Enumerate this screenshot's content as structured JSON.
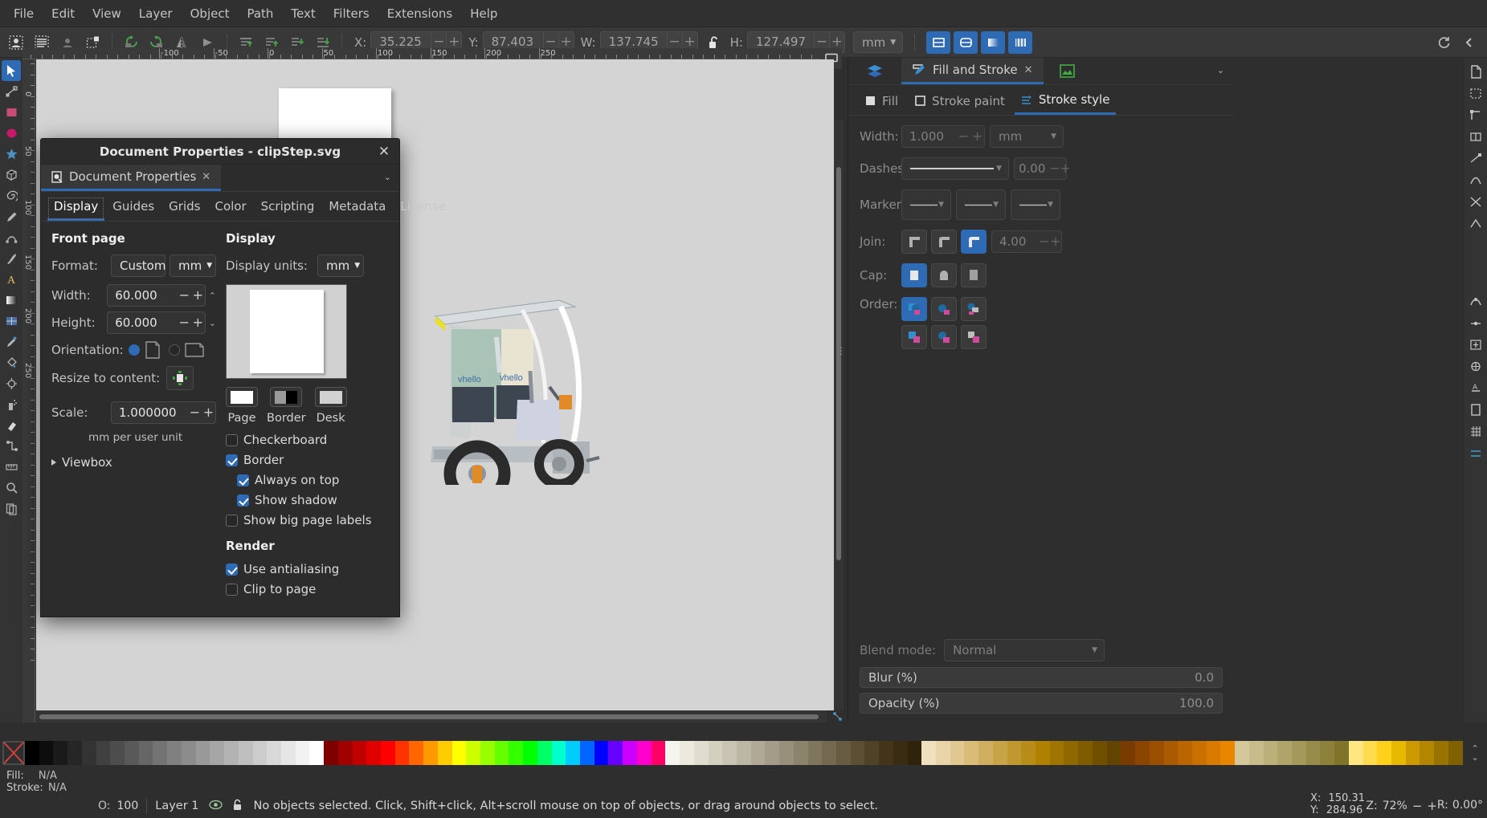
{
  "menubar": {
    "items": [
      "File",
      "Edit",
      "View",
      "Layer",
      "Object",
      "Path",
      "Text",
      "Filters",
      "Extensions",
      "Help"
    ]
  },
  "toolbar": {
    "x_label": "X:",
    "x_value": "35.225",
    "y_label": "Y:",
    "y_value": "87.403",
    "w_label": "W:",
    "w_value": "137.745",
    "h_label": "H:",
    "h_value": "127.497",
    "unit": "mm",
    "lock_icon": "unlocked-padlock-icon"
  },
  "dialog": {
    "title": "Document Properties - clipStep.svg",
    "dock_tab": "Document Properties",
    "tabs": [
      "Display",
      "Guides",
      "Grids",
      "Color",
      "Scripting",
      "Metadata",
      "License"
    ],
    "active_tab": "Display",
    "front_page": {
      "heading": "Front page",
      "format_label": "Format:",
      "format_value": "Custom",
      "format_unit": "mm",
      "width_label": "Width:",
      "width_value": "60.000",
      "height_label": "Height:",
      "height_value": "60.000",
      "orientation_label": "Orientation:",
      "orientation_portrait_selected": true,
      "orientation_landscape_selected": false,
      "resize_label": "Resize to content:",
      "scale_label": "Scale:",
      "scale_value": "1.000000",
      "scale_hint": "mm per user unit",
      "viewbox_label": "Viewbox"
    },
    "display": {
      "heading": "Display",
      "units_label": "Display units:",
      "units_value": "mm",
      "swatches": [
        {
          "label": "Page",
          "color": "#ffffff"
        },
        {
          "label": "Border",
          "color": "#000000"
        },
        {
          "label": "Desk",
          "color": "#d1d1d1"
        }
      ],
      "checkboxes": [
        {
          "label": "Checkerboard",
          "checked": false,
          "indent": false
        },
        {
          "label": "Border",
          "checked": true,
          "indent": false
        },
        {
          "label": "Always on top",
          "checked": true,
          "indent": true
        },
        {
          "label": "Show shadow",
          "checked": true,
          "indent": true
        },
        {
          "label": "Show big page labels",
          "checked": false,
          "indent": false
        }
      ],
      "render_heading": "Render",
      "render_checkboxes": [
        {
          "label": "Use antialiasing",
          "checked": true
        },
        {
          "label": "Clip to page",
          "checked": false
        }
      ]
    }
  },
  "right_panel": {
    "tab_label": "Fill and Stroke",
    "subtabs": [
      {
        "label": "Fill",
        "icon": "fill-square-icon",
        "active": false
      },
      {
        "label": "Stroke paint",
        "icon": "stroke-square-icon",
        "active": false
      },
      {
        "label": "Stroke style",
        "icon": "stroke-style-icon",
        "active": true
      }
    ],
    "width_label": "Width:",
    "width_value": "1.000",
    "width_unit": "mm",
    "dashes_label": "Dashes:",
    "dash_offset": "0.00",
    "markers_label": "Markers:",
    "join_label": "Join:",
    "miter_value": "4.00",
    "cap_label": "Cap:",
    "order_label": "Order:",
    "blend_label": "Blend mode:",
    "blend_value": "Normal",
    "blur_label": "Blur (%)",
    "blur_value": "0.0",
    "opacity_label": "Opacity (%)",
    "opacity_value": "100.0"
  },
  "statusbar": {
    "fill_label": "Fill:",
    "fill_value": "N/A",
    "stroke_label": "Stroke:",
    "stroke_value": "N/A",
    "opacity_label": "O:",
    "opacity_value": "100",
    "layer": "Layer 1",
    "message": "No objects selected. Click, Shift+click, Alt+scroll mouse on top of objects, or drag around objects to select.",
    "x_label": "X:",
    "x_value": "150.31",
    "y_label": "Y:",
    "y_value": "284.96",
    "zoom_label": "Z:",
    "zoom_value": "72%",
    "rotation_label": "R:",
    "rotation_value": "0.00°"
  },
  "rulers": {
    "horizontal_ticks": [
      "-100",
      "-50",
      "0",
      "50",
      "100",
      "150",
      "200",
      "250"
    ],
    "vertical_ticks": [
      "0",
      "50",
      "100",
      "150",
      "200",
      "250"
    ]
  },
  "colors": {
    "accent": "#2f6ab5",
    "panel_bg": "#2e2e2e",
    "canvas_bg": "#d4d4d4",
    "page_bg": "#ffffff"
  },
  "palette": [
    "#000000",
    "#0d0d0d",
    "#1a1a1a",
    "#262626",
    "#333333",
    "#404040",
    "#4d4d4d",
    "#595959",
    "#666666",
    "#737373",
    "#808080",
    "#8c8c8c",
    "#999999",
    "#a6a6a6",
    "#b3b3b3",
    "#bfbfbf",
    "#cccccc",
    "#d9d9d9",
    "#e6e6e6",
    "#f2f2f2",
    "#ffffff",
    "#800000",
    "#a00000",
    "#c00000",
    "#e00000",
    "#ff0000",
    "#ff3300",
    "#ff6600",
    "#ff9900",
    "#ffcc00",
    "#ffff00",
    "#ccff00",
    "#99ff00",
    "#66ff00",
    "#33ff00",
    "#00ff00",
    "#00ff66",
    "#00ffcc",
    "#00ccff",
    "#0066ff",
    "#0000ff",
    "#6600ff",
    "#cc00ff",
    "#ff00cc",
    "#ff0066",
    "#f5f5f0",
    "#ece9dd",
    "#e0ddd0",
    "#d4d0c0",
    "#c8c3b2",
    "#bcb6a4",
    "#b0a996",
    "#a49c88",
    "#98907a",
    "#8c836c",
    "#80765e",
    "#746950",
    "#685c42",
    "#5c4f34",
    "#504226",
    "#443518",
    "#3a2c12",
    "#30230c",
    "#f0e0c0",
    "#e8d4a8",
    "#e0c890",
    "#d8bc78",
    "#d0b060",
    "#c8a448",
    "#c09830",
    "#b88c18",
    "#b08000",
    "#a07400",
    "#906800",
    "#805c00",
    "#705000",
    "#604400",
    "#7a3b00",
    "#8a4500",
    "#9a5000",
    "#aa5a00",
    "#ba6500",
    "#ca7000",
    "#da7a00",
    "#ea8500",
    "#d4c89a",
    "#c8bc8a",
    "#bcb07a",
    "#b0a46a",
    "#a4985a",
    "#988c4a",
    "#8c803a",
    "#80742a",
    "#ffe680",
    "#ffdb4d",
    "#ffd11a",
    "#e6b800",
    "#cc9a00",
    "#b38600",
    "#997300",
    "#806000"
  ]
}
